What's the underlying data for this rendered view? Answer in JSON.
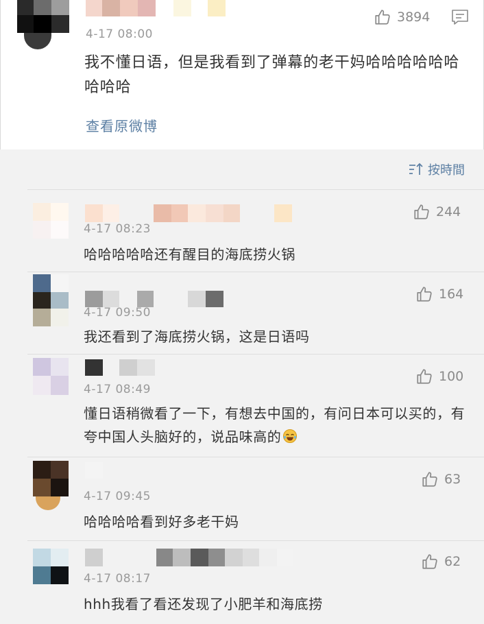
{
  "main_post": {
    "time": "4-17 08:00",
    "text": "我不懂日语，但是我看到了弹幕的老干妈哈哈哈哈哈哈哈哈哈",
    "likes": "3894",
    "view_original_label": "查看原微博"
  },
  "sort": {
    "label": "按時間",
    "icon": "sort-time-icon"
  },
  "comments": [
    {
      "time": "4-17 08:23",
      "text": "哈哈哈哈哈还有醒目的海底捞火锅",
      "likes": "244"
    },
    {
      "time": "4-17 09:50",
      "text": "我还看到了海底捞火锅，这是日语吗",
      "likes": "164"
    },
    {
      "time": "4-17 08:49",
      "text": "懂日语稍微看了一下，有想去中国的，有问日本可以买的，有夸中国人头脑好的，说品味高的",
      "emoji": "laughing-tears-emoji",
      "likes": "100"
    },
    {
      "time": "4-17 09:45",
      "text": "哈哈哈哈看到好多老干妈",
      "likes": "63"
    },
    {
      "time": "4-17 08:17",
      "text": "hhh我看了看还发现了小肥羊和海底捞",
      "likes": "62"
    }
  ],
  "colors": {
    "link": "#5c7fa3",
    "muted": "#9a9a9a",
    "text": "#333333",
    "page_bg": "#f2f2f2"
  }
}
